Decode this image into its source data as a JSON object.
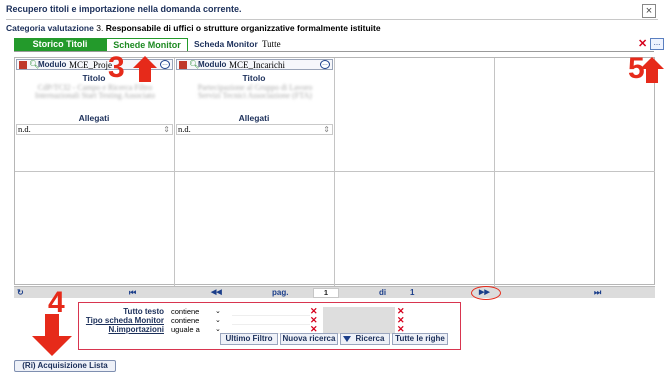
{
  "dialog": {
    "title": "Recupero titoli e importazione nella domanda corrente.",
    "close_glyph": "×"
  },
  "categoria": {
    "label": "Categoria valutazione",
    "number": "3.",
    "value": "Responsabile di uffici o strutture organizzative formalmente istituite"
  },
  "tabs": [
    {
      "label": "Storico Titoli",
      "active": true
    },
    {
      "label": "Schede Monitor",
      "active": false
    }
  ],
  "scheda_monitor": {
    "label": "Scheda Monitor",
    "value": "Tutte",
    "clear_glyph": "✕",
    "more_glyph": "..."
  },
  "cards": [
    {
      "modulo_label": "Modulo",
      "modulo_value": "MCE_Proje",
      "titolo_label": "Titolo",
      "titolo_blurred": "CdP/TCI2 - Campo e Ricerca Filtro Internazionali Start Testing Associato Italiana 2022",
      "allegati_label": "Allegati",
      "allegati_value": "n.d."
    },
    {
      "modulo_label": "Modulo",
      "modulo_value": "MCE_Incarichi",
      "titolo_label": "Titolo",
      "titolo_blurred": "Partecipazione al Gruppo di Lavoro Servizi Tecnici Associazione (FTA) Tavolo Consultivo membri",
      "allegati_label": "Allegati",
      "allegati_value": "n.d."
    }
  ],
  "pager": {
    "refresh_glyph": "↻",
    "first_glyph": "⏮",
    "prev_glyph": "◀◀",
    "page_label": "pag.",
    "page_value": "1",
    "of_label": "di",
    "of_value": "1",
    "next_glyph": "▶▶",
    "last_glyph": "⏭"
  },
  "filters": [
    {
      "label": "Tutto testo",
      "operator": "contiene"
    },
    {
      "label": "Tipo scheda Monitor",
      "operator": "contiene"
    },
    {
      "label": "N.importazioni",
      "operator": "uguale a"
    }
  ],
  "filter_buttons": {
    "ultimo_filtro": "Ultimo Filtro",
    "nuova_ricerca": "Nuova ricerca",
    "ricerca": "Ricerca",
    "tutte_righe": "Tutte le righe"
  },
  "acquisizione_button": "(Ri) Acquisizione Lista",
  "annotations": {
    "three": "3",
    "four": "4",
    "five": "5"
  },
  "colors": {
    "tab_active_bg": "#239a2b",
    "accent_red": "#e62a1a",
    "label_blue": "#1b2f5a"
  }
}
